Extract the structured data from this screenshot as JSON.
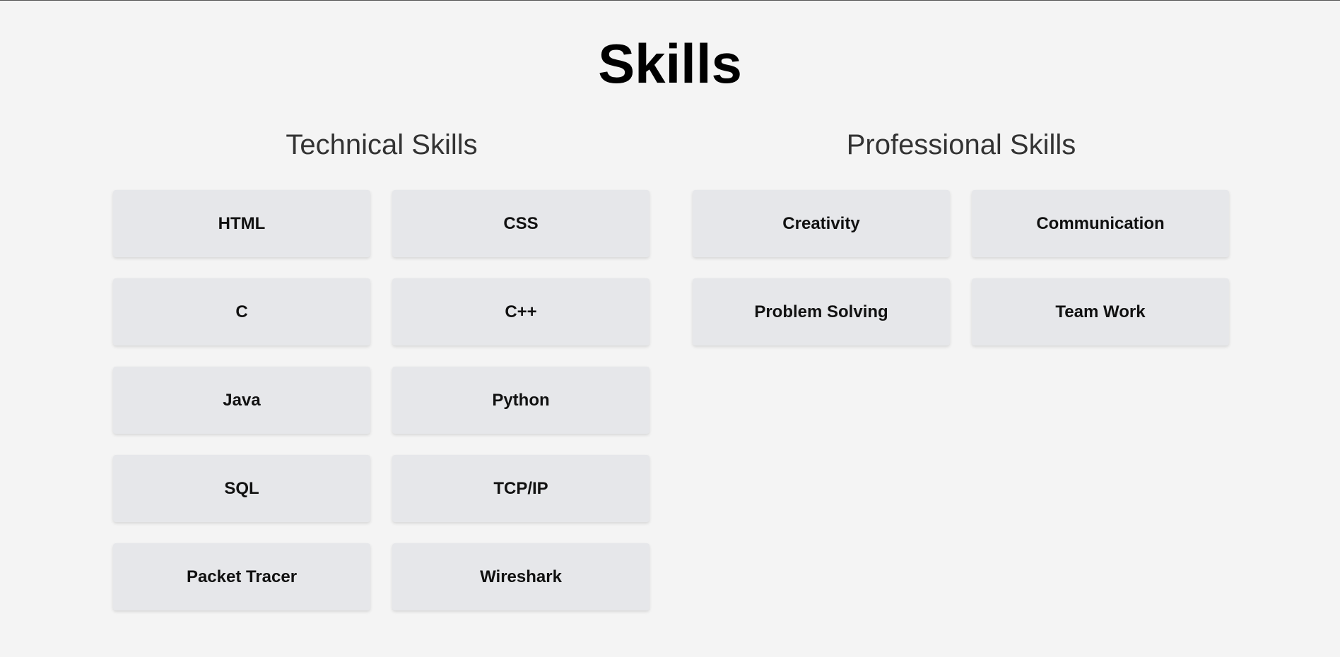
{
  "page": {
    "title": "Skills"
  },
  "technical": {
    "title": "Technical Skills",
    "items": [
      "HTML",
      "CSS",
      "C",
      "C++",
      "Java",
      "Python",
      "SQL",
      "TCP/IP",
      "Packet Tracer",
      "Wireshark"
    ]
  },
  "professional": {
    "title": "Professional Skills",
    "items": [
      "Creativity",
      "Communication",
      "Problem Solving",
      "Team Work"
    ]
  },
  "colors": {
    "background": "#f4f4f4",
    "card": "#e6e7ea",
    "heading": "#000000",
    "subheading": "#333333"
  }
}
